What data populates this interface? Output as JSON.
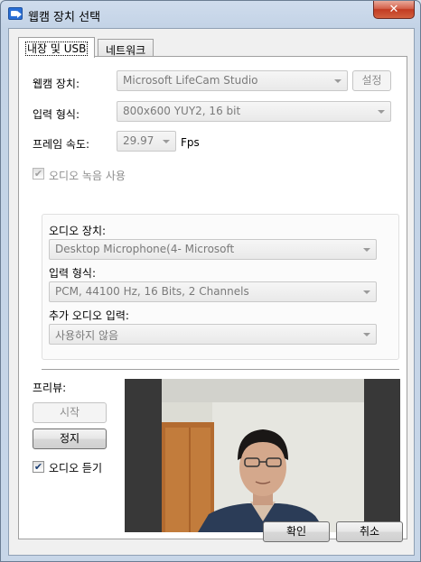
{
  "window": {
    "title": "웹캠 장치 선택",
    "close_label": "✕"
  },
  "tabs": [
    {
      "label": "내장 및 USB",
      "active": true
    },
    {
      "label": "네트워크",
      "active": false
    }
  ],
  "form": {
    "device_label": "웹캠 장치:",
    "device_value": "Microsoft LifeCam Studio",
    "settings_button": "설정",
    "format_label": "입력 형식:",
    "format_value": "800x600 YUY2, 16 bit",
    "framerate_label": "프레임 속도:",
    "framerate_value": "29.97",
    "framerate_unit": "Fps",
    "audio_record_label": "오디오 녹음 사용",
    "audio_record_checked": true
  },
  "audio": {
    "device_label": "오디오 장치:",
    "device_value": "Desktop Microphone(4- Microsoft",
    "format_label": "입력 형식:",
    "format_value": "PCM, 44100 Hz, 16 Bits, 2 Channels",
    "extra_label": "추가 오디오 입력:",
    "extra_value": "사용하지 않음"
  },
  "preview": {
    "label": "프리뷰:",
    "start_button": "시작",
    "stop_button": "정지",
    "listen_label": "오디오 듣기",
    "listen_checked": true
  },
  "footer": {
    "ok_button": "확인",
    "cancel_button": "취소"
  },
  "checkmark": "✔",
  "colors": {
    "titlebar": "#c3d3e6",
    "close_button": "#c23b22",
    "preview_background": "#383838"
  }
}
